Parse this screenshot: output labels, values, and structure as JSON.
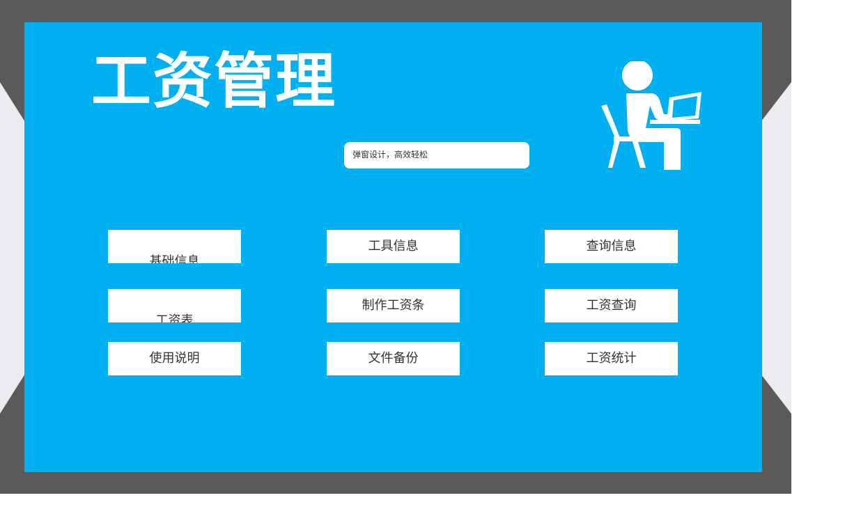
{
  "app": {
    "title": "工资管理",
    "subtitle": "弹窗设计，高效轻松"
  },
  "icons": {
    "hero": "person-at-laptop-icon"
  },
  "colors": {
    "panel": "#00b0f0",
    "frame": "#5a5a5a",
    "button_bg": "#ffffff",
    "text": "#333333"
  },
  "buttons": [
    {
      "label": "基础信息"
    },
    {
      "label": "工具信息"
    },
    {
      "label": "查询信息"
    },
    {
      "label": "工资表"
    },
    {
      "label": "制作工资条"
    },
    {
      "label": "工资查询"
    },
    {
      "label": "使用说明"
    },
    {
      "label": "文件备份"
    },
    {
      "label": "工资统计"
    }
  ]
}
